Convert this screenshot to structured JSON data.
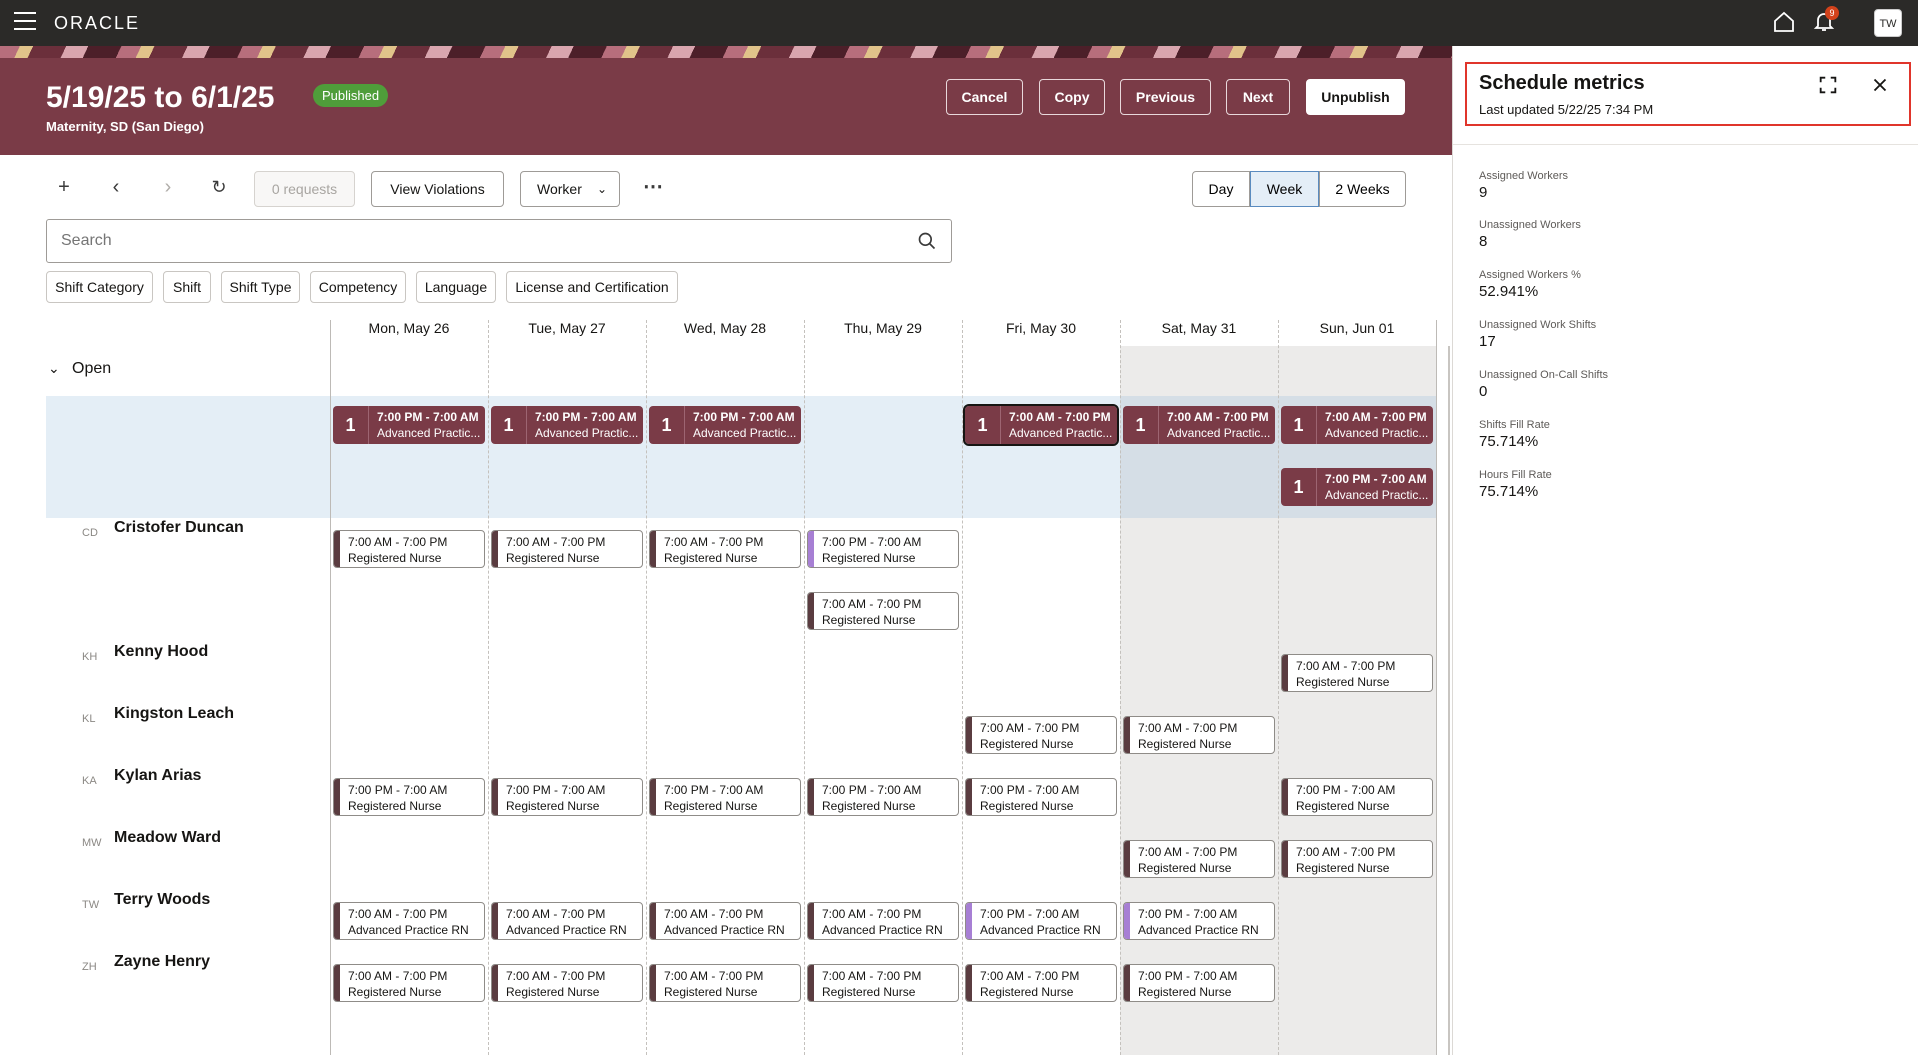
{
  "app": {
    "logo": "ORACLE",
    "notif_count": "9",
    "user_initials": "TW"
  },
  "schedule": {
    "title": "5/19/25 to 6/1/25",
    "status": "Published",
    "subtitle": "Maternity, SD (San Diego)",
    "buttons": {
      "cancel": "Cancel",
      "copy": "Copy",
      "previous": "Previous",
      "next": "Next",
      "unpublish": "Unpublish"
    }
  },
  "toolbar": {
    "requests": "0 requests",
    "view_violations": "View Violations",
    "worker": "Worker",
    "views": {
      "day": "Day",
      "week": "Week",
      "two_weeks": "2 Weeks"
    },
    "active_view": "Week"
  },
  "search": {
    "placeholder": "Search"
  },
  "filters": [
    "Shift Category",
    "Shift",
    "Shift Type",
    "Competency",
    "Language",
    "License and Certification"
  ],
  "days": [
    "Mon, May 26",
    "Tue, May 27",
    "Wed, May 28",
    "Thu, May 29",
    "Fri, May 30",
    "Sat, May 31",
    "Sun, Jun 01"
  ],
  "open_section": {
    "label": "Open",
    "shifts": [
      {
        "count": "1",
        "time": "7:00 PM - 7:00 AM",
        "role": "Advanced Practic..."
      },
      {
        "count": "1",
        "time": "7:00 PM - 7:00 AM",
        "role": "Advanced Practic..."
      },
      {
        "count": "1",
        "time": "7:00 PM - 7:00 AM",
        "role": "Advanced Practic..."
      },
      {
        "count": "1",
        "time": "7:00 AM - 7:00 PM",
        "role": "Advanced Practic..."
      },
      {
        "count": "1",
        "time": "7:00 AM - 7:00 PM",
        "role": "Advanced Practic..."
      },
      {
        "count": "1",
        "time": "7:00 AM - 7:00 PM",
        "role": "Advanced Practic..."
      },
      {
        "count": "1",
        "time": "7:00 PM - 7:00 AM",
        "role": "Advanced Practic..."
      }
    ]
  },
  "workers": [
    {
      "initials": "CD",
      "name": "Cristofer Duncan"
    },
    {
      "initials": "KH",
      "name": "Kenny Hood"
    },
    {
      "initials": "KL",
      "name": "Kingston Leach"
    },
    {
      "initials": "KA",
      "name": "Kylan Arias"
    },
    {
      "initials": "MW",
      "name": "Meadow Ward"
    },
    {
      "initials": "TW",
      "name": "Terry Woods"
    },
    {
      "initials": "ZH",
      "name": "Zayne Henry"
    }
  ],
  "shifts": {
    "cd_mon": {
      "time": "7:00 AM - 7:00 PM",
      "role": "Registered Nurse"
    },
    "cd_tue": {
      "time": "7:00 AM - 7:00 PM",
      "role": "Registered Nurse"
    },
    "cd_wed": {
      "time": "7:00 AM - 7:00 PM",
      "role": "Registered Nurse"
    },
    "cd_thu": {
      "time": "7:00 PM - 7:00 AM",
      "role": "Registered Nurse"
    },
    "cd_thu2": {
      "time": "7:00 AM - 7:00 PM",
      "role": "Registered Nurse"
    },
    "kh_sun": {
      "time": "7:00 AM - 7:00 PM",
      "role": "Registered Nurse"
    },
    "kl_fri": {
      "time": "7:00 AM - 7:00 PM",
      "role": "Registered Nurse"
    },
    "kl_sat": {
      "time": "7:00 AM - 7:00 PM",
      "role": "Registered Nurse"
    },
    "ka_mon": {
      "time": "7:00 PM - 7:00 AM",
      "role": "Registered Nurse"
    },
    "ka_tue": {
      "time": "7:00 PM - 7:00 AM",
      "role": "Registered Nurse"
    },
    "ka_wed": {
      "time": "7:00 PM - 7:00 AM",
      "role": "Registered Nurse"
    },
    "ka_thu": {
      "time": "7:00 PM - 7:00 AM",
      "role": "Registered Nurse"
    },
    "ka_fri": {
      "time": "7:00 PM - 7:00 AM",
      "role": "Registered Nurse"
    },
    "ka_sun": {
      "time": "7:00 PM - 7:00 AM",
      "role": "Registered Nurse"
    },
    "mw_sat": {
      "time": "7:00 AM - 7:00 PM",
      "role": "Registered Nurse"
    },
    "mw_sun": {
      "time": "7:00 AM - 7:00 PM",
      "role": "Registered Nurse"
    },
    "tw_mon": {
      "time": "7:00 AM - 7:00 PM",
      "role": "Advanced Practice RN"
    },
    "tw_tue": {
      "time": "7:00 AM - 7:00 PM",
      "role": "Advanced Practice RN"
    },
    "tw_wed": {
      "time": "7:00 AM - 7:00 PM",
      "role": "Advanced Practice RN"
    },
    "tw_thu": {
      "time": "7:00 AM - 7:00 PM",
      "role": "Advanced Practice RN"
    },
    "tw_fri": {
      "time": "7:00 PM - 7:00 AM",
      "role": "Advanced Practice RN"
    },
    "tw_sat": {
      "time": "7:00 PM - 7:00 AM",
      "role": "Advanced Practice RN"
    },
    "zh_mon": {
      "time": "7:00 AM - 7:00 PM",
      "role": "Registered Nurse"
    },
    "zh_tue": {
      "time": "7:00 AM - 7:00 PM",
      "role": "Registered Nurse"
    },
    "zh_wed": {
      "time": "7:00 AM - 7:00 PM",
      "role": "Registered Nurse"
    },
    "zh_thu": {
      "time": "7:00 AM - 7:00 PM",
      "role": "Registered Nurse"
    },
    "zh_fri": {
      "time": "7:00 AM - 7:00 PM",
      "role": "Registered Nurse"
    },
    "zh_sat": {
      "time": "7:00 PM - 7:00 AM",
      "role": "Registered Nurse"
    }
  },
  "metrics_panel": {
    "title": "Schedule metrics",
    "last_updated": "Last updated 5/22/25 7:34 PM",
    "metrics": [
      {
        "label": "Assigned Workers",
        "value": "9"
      },
      {
        "label": "Unassigned Workers",
        "value": "8"
      },
      {
        "label": "Assigned Workers %",
        "value": "52.941%"
      },
      {
        "label": "Unassigned Work Shifts",
        "value": "17"
      },
      {
        "label": "Unassigned On-Call Shifts",
        "value": "0"
      },
      {
        "label": "Shifts Fill Rate",
        "value": "75.714%"
      },
      {
        "label": "Hours Fill Rate",
        "value": "75.714%"
      }
    ]
  },
  "colors": {
    "banner": "#7a3b47",
    "topbar": "#2b2a28",
    "open_row": "#e4eef6",
    "panel_highlight": "#e0352b",
    "published": "#4f9d3a"
  }
}
